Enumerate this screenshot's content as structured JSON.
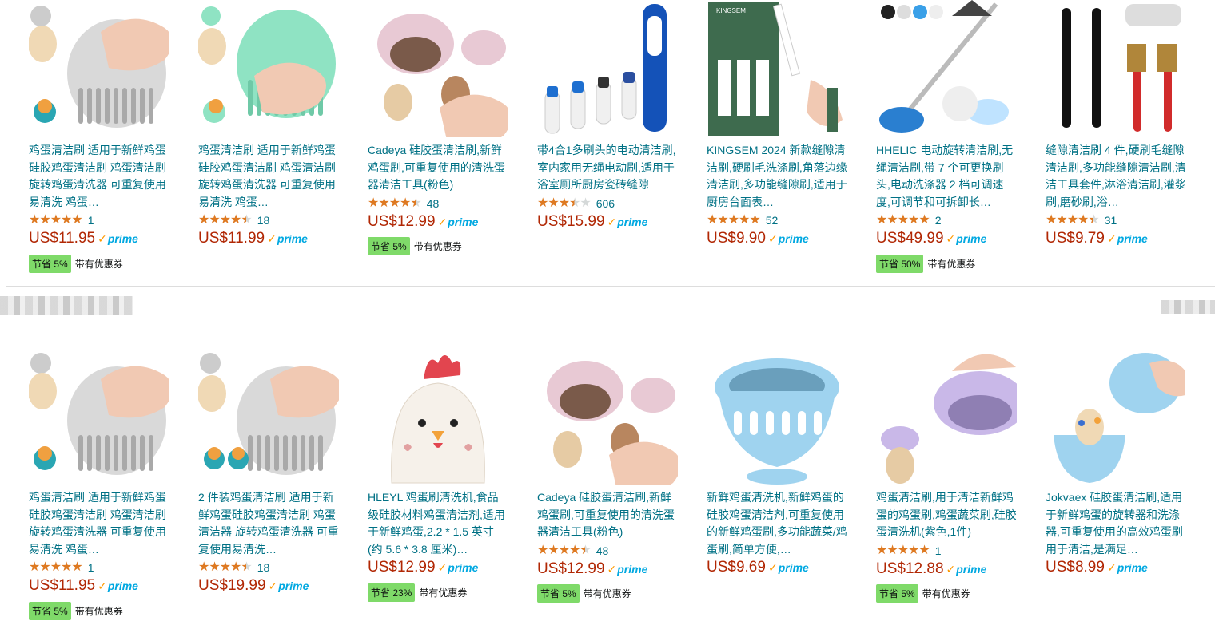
{
  "colors": {
    "link": "#007185",
    "price": "#b12704",
    "star": "#de7921",
    "deal_badge": "#7fda69",
    "prime": "#00a8e1"
  },
  "row1": [
    {
      "title": "鸡蛋清洁刷 适用于新鲜鸡蛋 硅胶鸡蛋清洁刷 鸡蛋清洁刷 旋转鸡蛋清洗器 可重复使用易清洗 鸡蛋…",
      "rating": 5,
      "reviews": "1",
      "price": "US$11.95",
      "prime": "prime",
      "deal": "节省 5%",
      "coupon": "带有优惠券",
      "image": "white-egg-scrubber"
    },
    {
      "title": "鸡蛋清洁刷 适用于新鲜鸡蛋 硅胶鸡蛋清洁刷 鸡蛋清洁刷 旋转鸡蛋清洗器 可重复使用易清洗 鸡蛋…",
      "rating": 4.5,
      "reviews": "18",
      "price": "US$11.99",
      "prime": "prime",
      "deal": "",
      "coupon": "",
      "image": "mint-egg-scrubber"
    },
    {
      "title": "Cadeya 硅胶蛋清洁刷,新鲜鸡蛋刷,可重复使用的清洗蛋器清洁工具(粉色)",
      "rating": 4.5,
      "reviews": "48",
      "price": "US$12.99",
      "prime": "prime",
      "deal": "节省 5%",
      "coupon": "带有优惠券",
      "image": "pink-egg-brush"
    },
    {
      "title": "带4合1多刷头的电动清洁刷,室内家用无绳电动刷,适用于浴室厕所厨房瓷砖缝隙",
      "rating": 3.5,
      "reviews": "606",
      "price": "US$15.99",
      "prime": "prime",
      "deal": "",
      "coupon": "",
      "image": "electric-brush-heads"
    },
    {
      "title": "KINGSEM 2024 新款缝隙清洁刷,硬刷毛洗涤刷,角落边缘清洁刷,多功能缝隙刷,适用于厨房台面表…",
      "rating": 5,
      "reviews": "52",
      "price": "US$9.90",
      "prime": "prime",
      "deal": "",
      "coupon": "",
      "image": "crevice-brushes"
    },
    {
      "title": "HHELIC 电动旋转清洁刷,无绳清洁刷,带 7 个可更换刷头,电动洗涤器 2 档可调速度,可调节和可拆卸长…",
      "rating": 5,
      "reviews": "2",
      "price": "US$49.99",
      "prime": "prime",
      "deal": "节省 50%",
      "coupon": "带有优惠券",
      "image": "spin-scrubber"
    },
    {
      "title": "缝隙清洁刷 4 件,硬刷毛缝隙清洁刷,多功能缝隙清洁刷,清洁工具套件,淋浴清洁刷,灌浆刷,磨砂刷,浴…",
      "rating": 4.5,
      "reviews": "31",
      "price": "US$9.79",
      "prime": "prime",
      "deal": "",
      "coupon": "",
      "image": "gap-brush-set"
    }
  ],
  "row2": [
    {
      "title": "鸡蛋清洁刷 适用于新鲜鸡蛋 硅胶鸡蛋清洁刷 鸡蛋清洁刷 旋转鸡蛋清洗器 可重复使用易清洗 鸡蛋…",
      "rating": 5,
      "reviews": "1",
      "price": "US$11.95",
      "prime": "prime",
      "deal": "节省 5%",
      "coupon": "带有优惠券",
      "image": "white-egg-scrubber"
    },
    {
      "title": "2 件装鸡蛋清洁刷 适用于新鲜鸡蛋硅胶鸡蛋清洁刷 鸡蛋清洁器 旋转鸡蛋清洗器 可重复使用易清洗…",
      "rating": 4.5,
      "reviews": "18",
      "price": "US$19.99",
      "prime": "prime",
      "deal": "",
      "coupon": "",
      "image": "two-egg-scrubbers"
    },
    {
      "title": "HLEYL 鸡蛋刷清洗机,食品级硅胶材料鸡蛋清洁剂,适用于新鲜鸡蛋,2.2 * 1.5 英寸(约 5.6 * 3.8 厘米)…",
      "rating": 0,
      "reviews": "",
      "price": "US$12.99",
      "prime": "prime",
      "deal": "节省 23%",
      "coupon": "带有优惠券",
      "image": "chicken-egg-washer"
    },
    {
      "title": "Cadeya 硅胶蛋清洁刷,新鲜鸡蛋刷,可重复使用的清洗蛋器清洁工具(粉色)",
      "rating": 4.5,
      "reviews": "48",
      "price": "US$12.99",
      "prime": "prime",
      "deal": "节省 5%",
      "coupon": "带有优惠券",
      "image": "pink-egg-brush"
    },
    {
      "title": "新鲜鸡蛋清洗机,新鲜鸡蛋的硅胶鸡蛋清洁剂,可重复使用的新鲜鸡蛋刷,多功能蔬菜/鸡蛋刷,简单方便,…",
      "rating": 0,
      "reviews": "",
      "price": "US$9.69",
      "prime": "prime",
      "deal": "",
      "coupon": "",
      "image": "blue-egg-cup"
    },
    {
      "title": "鸡蛋清洁刷,用于清洁新鲜鸡蛋的鸡蛋刷,鸡蛋蔬菜刷,硅胶蛋清洗机(紫色,1件)",
      "rating": 5,
      "reviews": "1",
      "price": "US$12.88",
      "prime": "prime",
      "deal": "节省 5%",
      "coupon": "带有优惠券",
      "image": "purple-egg-brush"
    },
    {
      "title": "Jokvaex 硅胶蛋清洁刷,适用于新鲜鸡蛋的旋转器和洗涤器,可重复使用的高效鸡蛋刷用于清洁,是满足…",
      "rating": 0,
      "reviews": "",
      "price": "US$8.99",
      "prime": "prime",
      "deal": "",
      "coupon": "",
      "image": "light-blue-egg-brush"
    }
  ]
}
